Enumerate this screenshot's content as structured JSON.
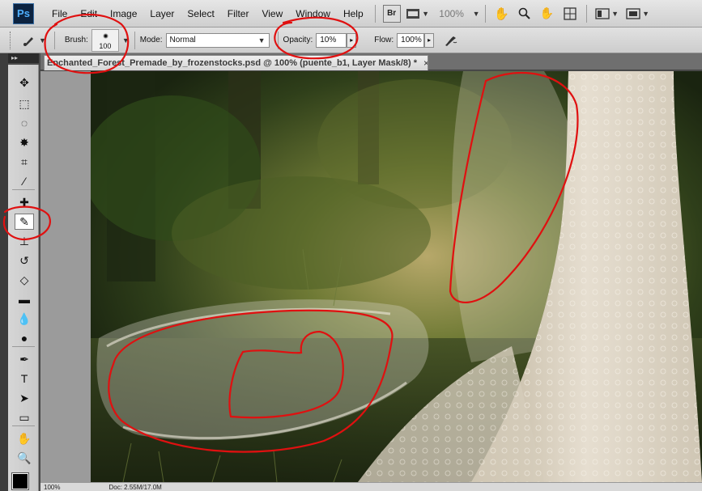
{
  "app": {
    "logo": "Ps"
  },
  "menu": [
    "File",
    "Edit",
    "Image",
    "Layer",
    "Select",
    "Filter",
    "View",
    "Window",
    "Help"
  ],
  "appbar": {
    "bridge_label": "Br",
    "zoom": "100%"
  },
  "options": {
    "brush_label": "Brush:",
    "brush_size": "100",
    "mode_label": "Mode:",
    "mode_value": "Normal",
    "opacity_label": "Opacity:",
    "opacity_value": "10%",
    "flow_label": "Flow:",
    "flow_value": "100%"
  },
  "document": {
    "tab_title": "Enchanted_Forest_Premade_by_frozenstocks.psd @ 100% (puente_b1, Layer Mask/8) *",
    "close_glyph": "×"
  },
  "status": {
    "zoom": "100%",
    "doc": "Doc: 2.55M/17.0M"
  },
  "tools": [
    {
      "name": "move-tool-icon",
      "glyph": "✥"
    },
    {
      "name": "marquee-tool-icon",
      "glyph": "⬚"
    },
    {
      "name": "lasso-tool-icon",
      "glyph": "◌"
    },
    {
      "name": "magic-wand-tool-icon",
      "glyph": "✸"
    },
    {
      "name": "crop-tool-icon",
      "glyph": "⌗"
    },
    {
      "name": "eyedropper-tool-icon",
      "glyph": "⁄"
    },
    {
      "name": "healing-brush-tool-icon",
      "glyph": "✚"
    },
    {
      "name": "brush-tool-icon",
      "glyph": "✎"
    },
    {
      "name": "clone-stamp-tool-icon",
      "glyph": "⊥"
    },
    {
      "name": "history-brush-tool-icon",
      "glyph": "↺"
    },
    {
      "name": "eraser-tool-icon",
      "glyph": "◇"
    },
    {
      "name": "gradient-tool-icon",
      "glyph": "▬"
    },
    {
      "name": "blur-tool-icon",
      "glyph": "💧"
    },
    {
      "name": "dodge-tool-icon",
      "glyph": "●"
    },
    {
      "name": "pen-tool-icon",
      "glyph": "✒"
    },
    {
      "name": "type-tool-icon",
      "glyph": "T"
    },
    {
      "name": "path-selection-tool-icon",
      "glyph": "➤"
    },
    {
      "name": "shape-tool-icon",
      "glyph": "▭"
    },
    {
      "name": "hand-tool-icon",
      "glyph": "✋"
    },
    {
      "name": "zoom-tool-icon",
      "glyph": "🔍"
    }
  ],
  "colors": {
    "annotation": "#e01010",
    "foreground": "#000000"
  }
}
